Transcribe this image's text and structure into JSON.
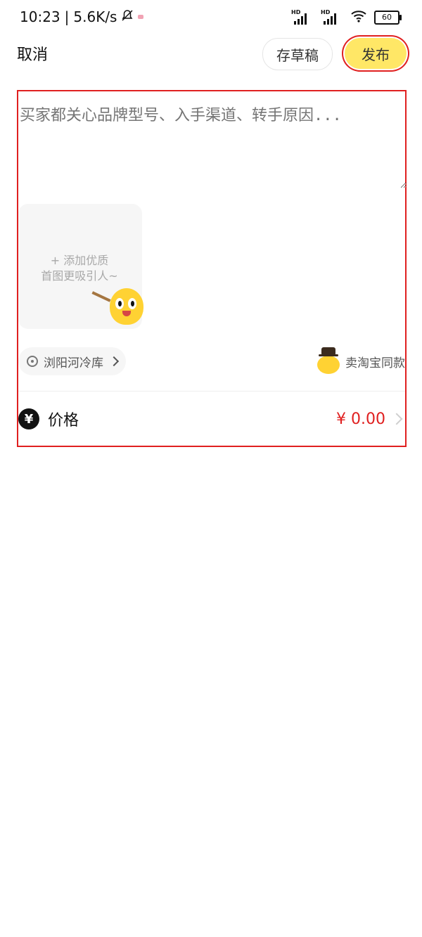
{
  "status_bar": {
    "time": "10:23",
    "speed": "5.6K/s",
    "battery": "60",
    "hd_label": "HD"
  },
  "header": {
    "cancel": "取消",
    "draft": "存草稿",
    "publish": "发布"
  },
  "editor": {
    "placeholder": "买家都关心品牌型号、入手渠道、转手原因...",
    "image_picker": {
      "line1": "+ 添加优质",
      "line2": "首图更吸引人~"
    },
    "location": {
      "label": "浏阳河冷库"
    },
    "same_style_label": "卖淘宝同款"
  },
  "price": {
    "label": "价格",
    "icon": "¥",
    "value": "¥ 0.00"
  },
  "colors": {
    "accent_yellow": "#ffe766",
    "highlight_red": "#e02020",
    "price_red": "#e02020"
  },
  "icons": {
    "mute": "bell-off-icon",
    "signal": "signal-icon",
    "wifi": "wifi-icon",
    "battery": "battery-icon",
    "location": "location-pin-icon",
    "price": "yen-icon",
    "chevron": "chevron-right-icon"
  }
}
